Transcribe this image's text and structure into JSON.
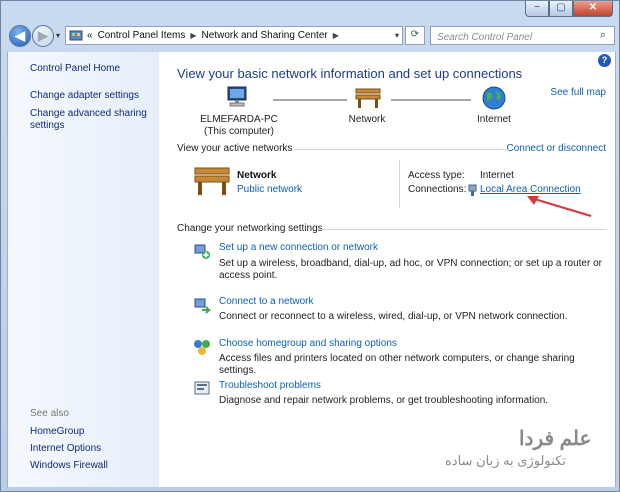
{
  "window": {
    "buttons": {
      "minimize": "−",
      "maximize": "▢",
      "close": "✕"
    }
  },
  "nav": {
    "back": "◀",
    "forward": "▶",
    "history": "▾",
    "refresh": "⟳"
  },
  "address": {
    "prefix": "«",
    "segments": [
      "Control Panel Items",
      "Network and Sharing Center"
    ],
    "separator": "▶",
    "dropdown": "▾"
  },
  "search": {
    "placeholder": "Search Control Panel"
  },
  "sidebar": {
    "home": "Control Panel Home",
    "links": [
      "Change adapter settings",
      "Change advanced sharing settings"
    ],
    "see_also": "See also",
    "see_also_items": [
      "HomeGroup",
      "Internet Options",
      "Windows Firewall"
    ]
  },
  "main": {
    "title": "View your basic network information and set up connections",
    "help": "?",
    "see_full_map": "See full map",
    "map": {
      "computer_name": "ELMEFARDA-PC",
      "computer_sub": "(This computer)",
      "network": "Network",
      "internet": "Internet"
    },
    "active_label": "View your active networks",
    "connect_disconnect": "Connect or disconnect",
    "active": {
      "name": "Network",
      "type": "Public network",
      "access_label": "Access type:",
      "access_value": "Internet",
      "connections_label": "Connections:",
      "connection_link": "Local Area Connection"
    },
    "settings_label": "Change your networking settings",
    "tasks": [
      {
        "title": "Set up a new connection or network",
        "desc": "Set up a wireless, broadband, dial-up, ad hoc, or VPN connection; or set up a router or access point."
      },
      {
        "title": "Connect to a network",
        "desc": "Connect or reconnect to a wireless, wired, dial-up, or VPN network connection."
      },
      {
        "title": "Choose homegroup and sharing options",
        "desc": "Access files and printers located on other network computers, or change sharing settings."
      },
      {
        "title": "Troubleshoot problems",
        "desc": "Diagnose and repair network problems, or get troubleshooting information."
      }
    ]
  },
  "watermark": {
    "line1": "علم فردا",
    "line2": "تکنولوژی به زبان ساده"
  },
  "colors": {
    "link": "#0c5fb5",
    "title": "#1e3a8a",
    "arrow": "#d9363e"
  }
}
